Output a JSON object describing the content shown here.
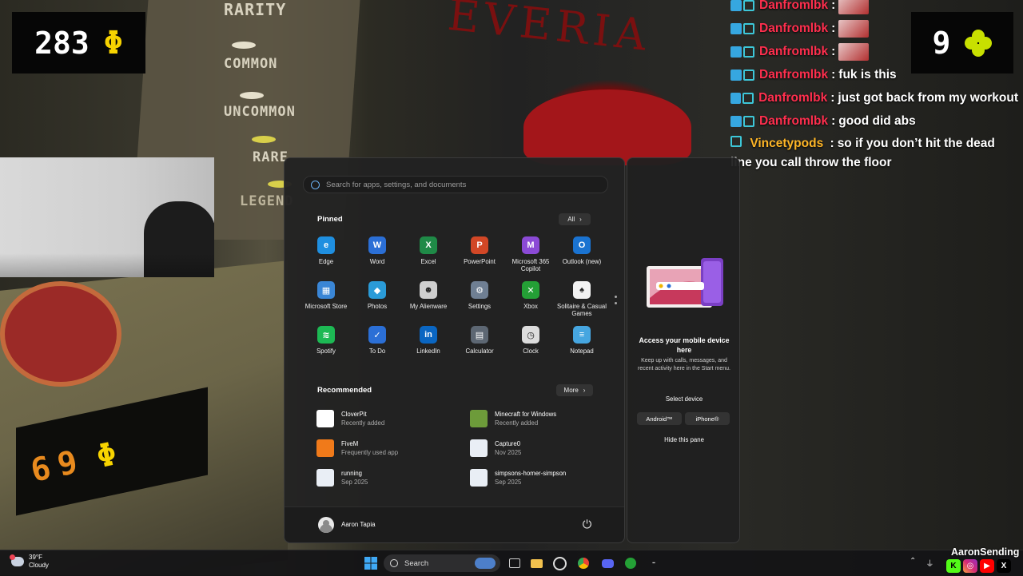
{
  "counters": {
    "coins": "283",
    "coin_symbol": "Φ",
    "clovers": "9",
    "machine_price": "69",
    "machine_symbol": "Φ"
  },
  "rarity": {
    "title": "RARITY",
    "common": "COMMON",
    "uncommon": "UNCOMMON",
    "rare": "RARE",
    "legendary": "LEGEND"
  },
  "game_sign": "EVERIA",
  "chat": {
    "messages": [
      {
        "user": "Danfromlbk",
        "text": ""
      },
      {
        "user": "Danfromlbk",
        "text": ""
      },
      {
        "user": "Danfromlbk",
        "text": ""
      },
      {
        "user": "Danfromlbk",
        "text": "fuk is this"
      },
      {
        "user": "Danfromlbk",
        "text": "just got back from my workout"
      },
      {
        "user": "Danfromlbk",
        "text": "good did abs"
      },
      {
        "user": "Vincetypods",
        "text": "so if you don’t hit the dead line you call throw the floor"
      }
    ],
    "separator": ":"
  },
  "start_menu": {
    "search_placeholder": "Search for apps, settings, and documents",
    "pinned_title": "Pinned",
    "all_label": "All",
    "pinned": [
      {
        "label": "Edge",
        "icon": "edge-icon",
        "color": "#1f8fe0"
      },
      {
        "label": "Word",
        "icon": "word-icon",
        "color": "#2b6fd6"
      },
      {
        "label": "Excel",
        "icon": "excel-icon",
        "color": "#1f8a47"
      },
      {
        "label": "PowerPoint",
        "icon": "powerpoint-icon",
        "color": "#d24726"
      },
      {
        "label": "Microsoft 365 Copilot",
        "icon": "copilot-icon",
        "color": "#8b4ad6"
      },
      {
        "label": "Outlook (new)",
        "icon": "outlook-icon",
        "color": "#1a73d1"
      },
      {
        "label": "Microsoft Store",
        "icon": "store-icon",
        "color": "#3a86d6"
      },
      {
        "label": "Photos",
        "icon": "photos-icon",
        "color": "#2a9bd8"
      },
      {
        "label": "My Alienware",
        "icon": "alienware-icon",
        "color": "#cfcfcf"
      },
      {
        "label": "Settings",
        "icon": "settings-icon",
        "color": "#6f7f93"
      },
      {
        "label": "Xbox",
        "icon": "xbox-icon",
        "color": "#24a036"
      },
      {
        "label": "Solitaire & Casual Games",
        "icon": "solitaire-icon",
        "color": "#f2f2f2"
      },
      {
        "label": "Spotify",
        "icon": "spotify-icon",
        "color": "#1db954"
      },
      {
        "label": "To Do",
        "icon": "todo-icon",
        "color": "#2b6fd6"
      },
      {
        "label": "LinkedIn",
        "icon": "linkedin-icon",
        "color": "#0a66c2"
      },
      {
        "label": "Calculator",
        "icon": "calculator-icon",
        "color": "#5d6773"
      },
      {
        "label": "Clock",
        "icon": "clock-icon",
        "color": "#dcdcdc"
      },
      {
        "label": "Notepad",
        "icon": "notepad-icon",
        "color": "#46a6e0"
      }
    ],
    "recommended_title": "Recommended",
    "more_label": "More",
    "recommended": [
      {
        "name": "CloverPit",
        "sub": "Recently added",
        "icon": "cloverpit-icon",
        "color": "#ffffff"
      },
      {
        "name": "Minecraft for Windows",
        "sub": "Recently added",
        "icon": "minecraft-icon",
        "color": "#6d9b3a"
      },
      {
        "name": "FiveM",
        "sub": "Frequently used app",
        "icon": "fivem-icon",
        "color": "#f07a1a"
      },
      {
        "name": "Capture0",
        "sub": "Nov 2025",
        "icon": "file-icon",
        "color": "#e9eef5"
      },
      {
        "name": "running",
        "sub": "Sep 2025",
        "icon": "file-icon",
        "color": "#e9eef5"
      },
      {
        "name": "simpsons-homer-simpson",
        "sub": "Sep 2025",
        "icon": "file-icon",
        "color": "#e9eef5"
      }
    ],
    "user_name": "Aaron Tapia"
  },
  "side_pane": {
    "title": "Access your mobile device here",
    "description": "Keep up with calls, messages, and recent activity here in the Start menu.",
    "select_device": "Select device",
    "android": "Android™",
    "iphone": "iPhone®",
    "hide": "Hide this pane"
  },
  "taskbar": {
    "temp": "39°F",
    "condition": "Cloudy",
    "search_label": "Search"
  },
  "overlay": {
    "streamer": "AaronSending"
  }
}
